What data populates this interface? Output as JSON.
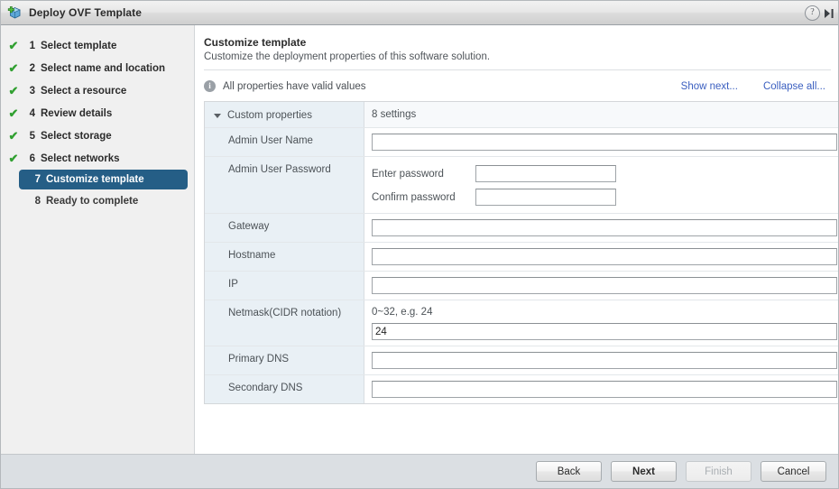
{
  "window": {
    "title": "Deploy OVF Template",
    "app_icon": "ovf-package-icon",
    "help_label": "?",
    "forward_label": "next-panel-icon"
  },
  "sidebar": {
    "steps": [
      {
        "num": "1",
        "label": "Select template",
        "state": "done"
      },
      {
        "num": "2",
        "label": "Select name and location",
        "state": "done"
      },
      {
        "num": "3",
        "label": "Select a resource",
        "state": "done"
      },
      {
        "num": "4",
        "label": "Review details",
        "state": "done"
      },
      {
        "num": "5",
        "label": "Select storage",
        "state": "done"
      },
      {
        "num": "6",
        "label": "Select networks",
        "state": "done"
      },
      {
        "num": "7",
        "label": "Customize template",
        "state": "current"
      },
      {
        "num": "8",
        "label": "Ready to complete",
        "state": "pending"
      }
    ],
    "check_glyph": "✔"
  },
  "content": {
    "title": "Customize template",
    "subtitle": "Customize the deployment properties of this software solution.",
    "status": {
      "icon": "info-icon",
      "glyph": "i",
      "text": "All properties have valid values"
    },
    "links": {
      "show_next": "Show next...",
      "collapse_all": "Collapse all..."
    },
    "group": {
      "name": "Custom properties",
      "settings_count": "8 settings"
    },
    "properties": [
      {
        "label": "Admin User Name",
        "type": "text",
        "value": "",
        "placeholder": ""
      },
      {
        "label": "Admin User Password",
        "type": "password-pair",
        "enter_label": "Enter password",
        "confirm_label": "Confirm password",
        "enter_value": "",
        "confirm_value": ""
      },
      {
        "label": "Gateway",
        "type": "text",
        "value": "",
        "placeholder": ""
      },
      {
        "label": "Hostname",
        "type": "text",
        "value": "",
        "placeholder": ""
      },
      {
        "label": "IP",
        "type": "text",
        "value": "",
        "placeholder": ""
      },
      {
        "label": "Netmask(CIDR notation)",
        "type": "text-with-hint",
        "hint": "0~32, e.g. 24",
        "value": "24",
        "placeholder": ""
      },
      {
        "label": "Primary DNS",
        "type": "text",
        "value": "",
        "placeholder": ""
      },
      {
        "label": "Secondary DNS",
        "type": "text",
        "value": "",
        "placeholder": ""
      }
    ]
  },
  "footer": {
    "back": "Back",
    "next": "Next",
    "finish": "Finish",
    "cancel": "Cancel"
  },
  "colors": {
    "selected_step": "#255e86",
    "check_green": "#31a031",
    "link_blue": "#3b5fc0",
    "label_cell": "#e9f0f5",
    "footer_bg": "#dbdfe3"
  }
}
